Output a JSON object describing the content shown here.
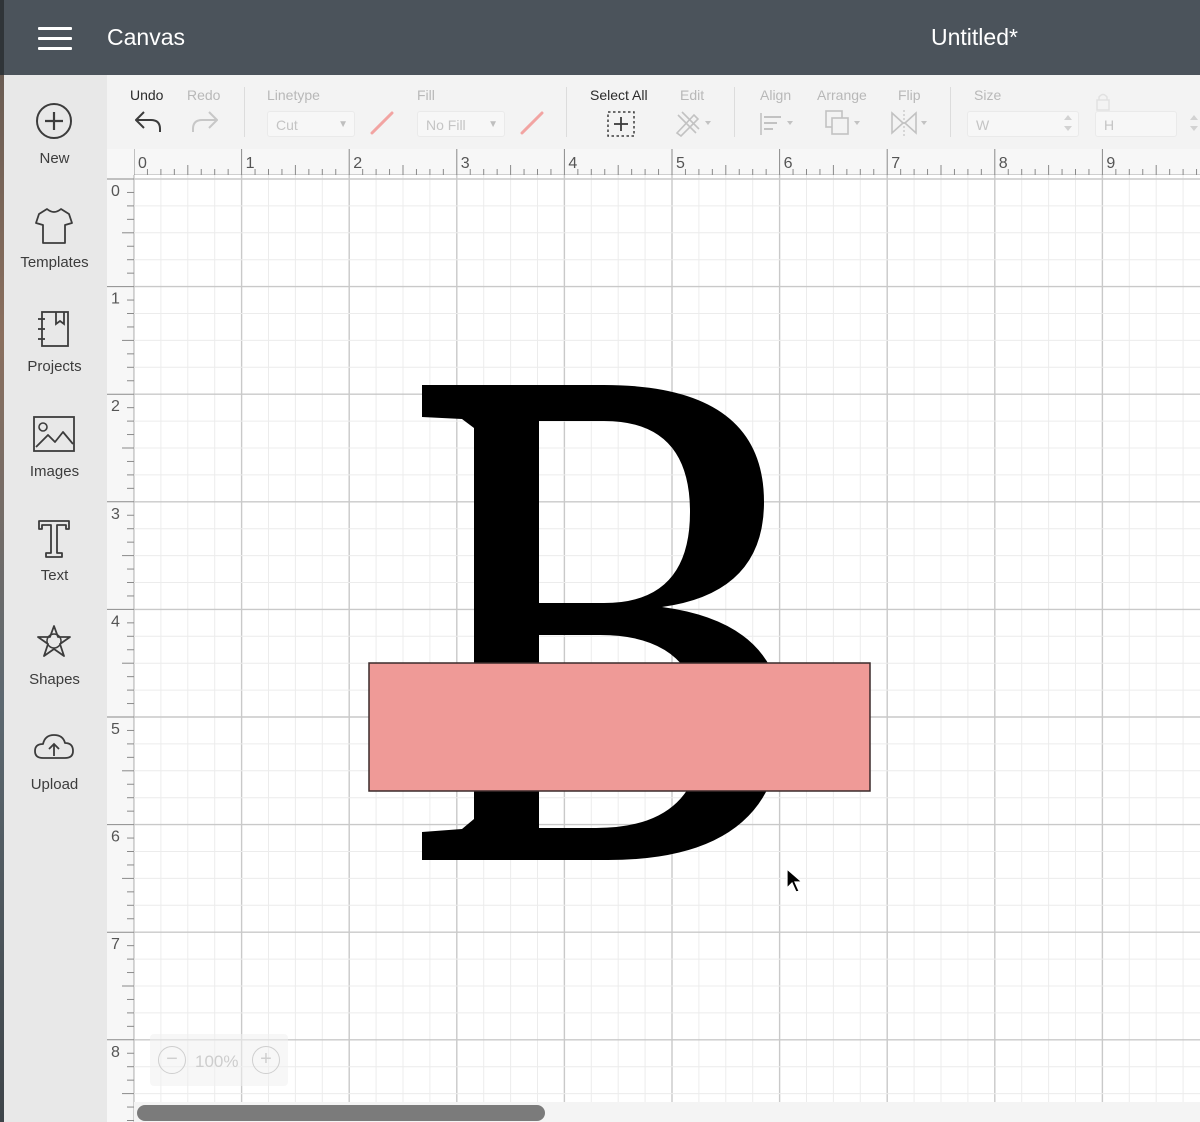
{
  "header": {
    "app_title": "Canvas",
    "doc_title": "Untitled*"
  },
  "sidebar": {
    "items": [
      {
        "label": "New",
        "icon": "plus-circle-icon"
      },
      {
        "label": "Templates",
        "icon": "tshirt-icon"
      },
      {
        "label": "Projects",
        "icon": "notebook-icon"
      },
      {
        "label": "Images",
        "icon": "image-icon"
      },
      {
        "label": "Text",
        "icon": "text-T-icon"
      },
      {
        "label": "Shapes",
        "icon": "shapes-icon"
      },
      {
        "label": "Upload",
        "icon": "cloud-upload-icon"
      }
    ]
  },
  "toolbar": {
    "undo": "Undo",
    "redo": "Redo",
    "linetype": {
      "label": "Linetype",
      "value": "Cut"
    },
    "fill": {
      "label": "Fill",
      "value": "No Fill"
    },
    "select_all": "Select All",
    "edit": "Edit",
    "align": "Align",
    "arrange": "Arrange",
    "flip": "Flip",
    "size": {
      "label": "Size",
      "w": "W",
      "h": "H"
    }
  },
  "rulers": {
    "top": [
      "0",
      "1",
      "2",
      "3",
      "4",
      "5",
      "6",
      "7",
      "8",
      "9"
    ],
    "left": [
      "0",
      "1",
      "2",
      "3",
      "4",
      "5",
      "6",
      "7",
      "8"
    ]
  },
  "canvas": {
    "letter": "B",
    "rectangle_color": "#ef9a97",
    "letter_color": "#000000"
  },
  "zoom": {
    "value": "100%"
  },
  "colors": {
    "header": "#4b535b",
    "sidebar": "#e8e8e8",
    "toolbar": "#f3f3f3"
  }
}
